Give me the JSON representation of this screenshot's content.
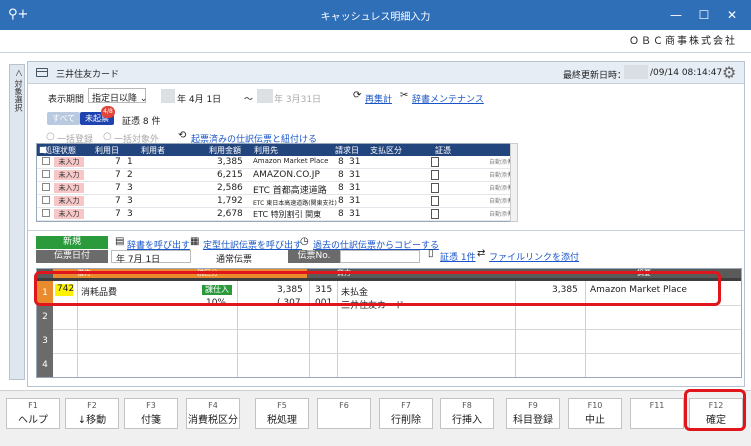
{
  "window": {
    "title": "キャッシュレス明細入力",
    "company": "ＯＢＣ商事株式会社"
  },
  "side_tab": {
    "label": "＜ 対象選択"
  },
  "card": {
    "name": "三井住友カード",
    "last_update_label": "最終更新日時：",
    "last_update_value": "/09/14 08:14:47"
  },
  "period": {
    "label": "表示期間",
    "mode": "指定日以降",
    "from": "年  4月  1日",
    "tilde": "〜",
    "to": "年  3月31日",
    "recalc": "再集計",
    "dict_maint": "辞書メンテナンス"
  },
  "filters": {
    "all": "すべて",
    "unrecorded": "未起票",
    "badge": "4/8",
    "count": "証憑 8 件"
  },
  "actions": {
    "bulk_register": "一括登録",
    "bulk_exclude": "一括対象外",
    "link_recorded": "起票済みの仕訳伝票と紐付ける"
  },
  "upper_grid": {
    "headers": [
      "処理状態",
      "利用日",
      "利用者",
      "利用金額",
      "利用先",
      "請求日",
      "支払区分",
      "証憑"
    ],
    "rows": [
      {
        "status": "未入力",
        "month": "7",
        "day": "1",
        "amount": "3,385",
        "merchant": "Amazon Market Place",
        "bill_m": "8",
        "bill_d": "31",
        "auto": "自動添付"
      },
      {
        "status": "未入力",
        "month": "7",
        "day": "2",
        "amount": "6,215",
        "merchant": "AMAZON.CO.JP",
        "bill_m": "8",
        "bill_d": "31",
        "auto": "自動添付"
      },
      {
        "status": "未入力",
        "month": "7",
        "day": "3",
        "amount": "2,586",
        "merchant": "ETC 首都高速道路",
        "bill_m": "8",
        "bill_d": "31",
        "auto": "自動添付"
      },
      {
        "status": "未入力",
        "month": "7",
        "day": "3",
        "amount": "1,792",
        "merchant": "ETC 東日本高速道路(関東支社)",
        "bill_m": "8",
        "bill_d": "31",
        "auto": "自動添付"
      },
      {
        "status": "未入力",
        "month": "7",
        "day": "3",
        "amount": "2,678",
        "merchant": "ETC 特別割引 関東",
        "bill_m": "8",
        "bill_d": "31",
        "auto": "自動添付"
      }
    ]
  },
  "entry": {
    "new_label": "新規",
    "call_dict": "辞書を呼び出す",
    "call_fixed": "定型仕訳伝票を呼び出す",
    "copy_past": "過去の仕訳伝票からコピーする",
    "evidence_count": "証憑 1件",
    "attach_link": "ファイルリンクを添付",
    "date_label": "伝票日付",
    "date_value": "年  7月  1日",
    "type_label": "通常伝票",
    "no_label": "伝票No."
  },
  "journal": {
    "header_debit": "借方",
    "header_tax": "税区分",
    "header_credit": "貸方",
    "header_summary": "摘要",
    "row_numbers": [
      "1",
      "2",
      "3",
      "4"
    ],
    "row1": {
      "debit_code": "742",
      "debit_name": "消耗品費",
      "tax": "課仕入",
      "tax_rate": "10%",
      "debit_amount": "3,385",
      "tax_amount": "( 307",
      "credit_code": "315",
      "credit_name": "未払金",
      "credit_sub_code": "001",
      "credit_sub_name": "三井住友カード",
      "credit_amount": "3,385",
      "summary": "Amazon Market Place"
    }
  },
  "fkeys": [
    {
      "key": "F1",
      "label": "ヘルプ"
    },
    {
      "key": "F2",
      "label": "↓移動"
    },
    {
      "key": "F3",
      "label": "付箋"
    },
    {
      "key": "F4",
      "label": "消費税区分"
    },
    {
      "key": "F5",
      "label": "税処理"
    },
    {
      "key": "F6",
      "label": ""
    },
    {
      "key": "F7",
      "label": "行削除"
    },
    {
      "key": "F8",
      "label": "行挿入"
    },
    {
      "key": "F9",
      "label": "科目登録"
    },
    {
      "key": "F10",
      "label": "中止"
    },
    {
      "key": "F11",
      "label": ""
    },
    {
      "key": "F12",
      "label": "確定"
    }
  ]
}
